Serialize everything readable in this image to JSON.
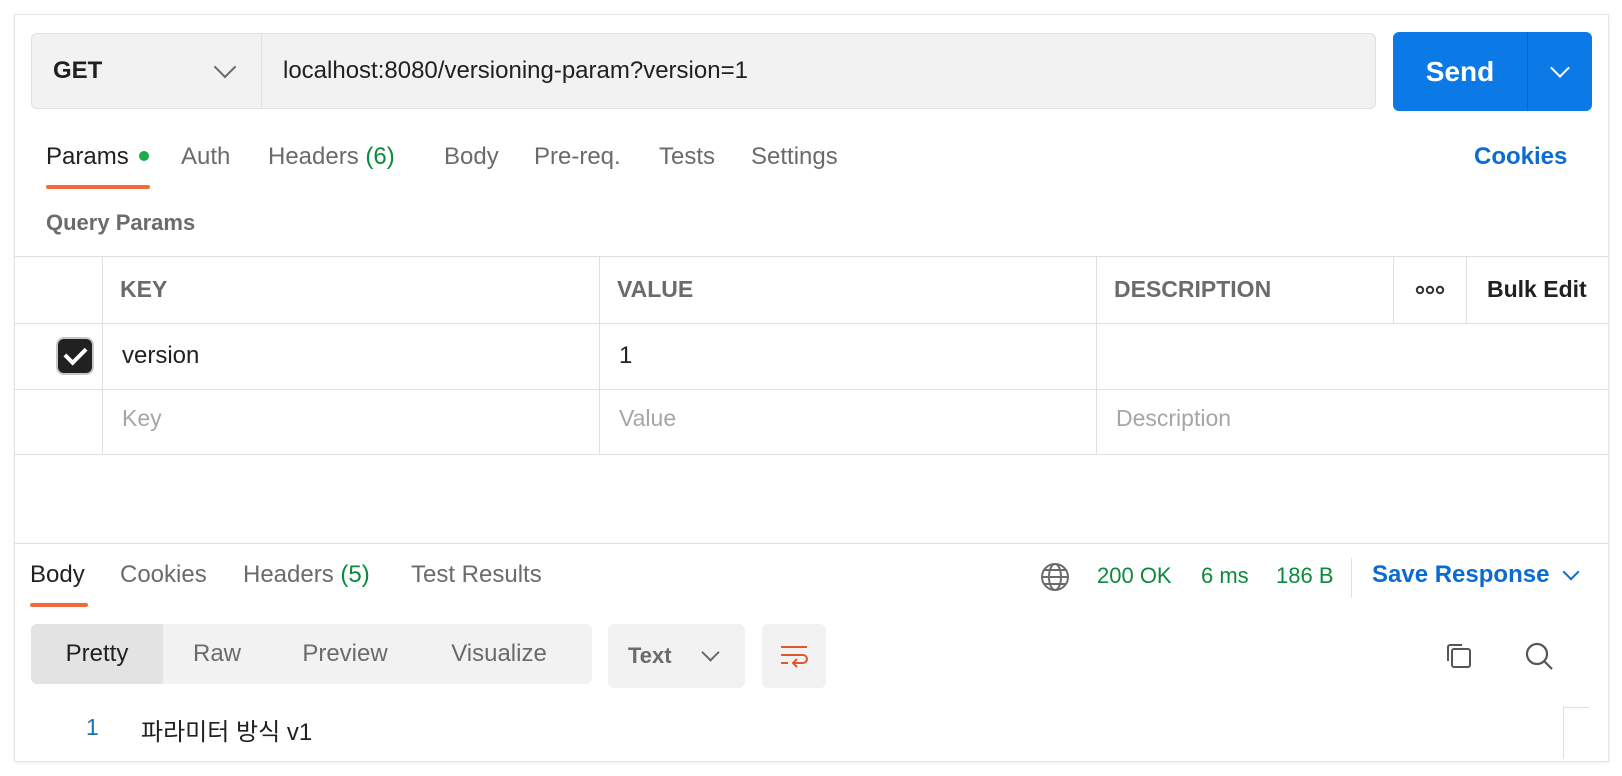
{
  "request": {
    "method": "GET",
    "url": "localhost:8080/versioning-param?version=1",
    "send_label": "Send"
  },
  "tabs": {
    "params": "Params",
    "auth": "Auth",
    "headers": "Headers",
    "headers_count": "(6)",
    "body": "Body",
    "prereq": "Pre-req.",
    "tests": "Tests",
    "settings": "Settings",
    "cookies": "Cookies"
  },
  "query_params": {
    "title": "Query Params",
    "columns": {
      "key": "KEY",
      "value": "VALUE",
      "description": "DESCRIPTION",
      "bulk_edit": "Bulk Edit"
    },
    "rows": [
      {
        "checked": true,
        "key": "version",
        "value": "1",
        "description": ""
      }
    ],
    "placeholders": {
      "key": "Key",
      "value": "Value",
      "description": "Description"
    }
  },
  "response": {
    "tabs": {
      "body": "Body",
      "cookies": "Cookies",
      "headers": "Headers",
      "headers_count": "(5)",
      "test_results": "Test Results"
    },
    "status": "200 OK",
    "time": "6 ms",
    "size": "186 B",
    "save_response": "Save Response",
    "view_modes": [
      "Pretty",
      "Raw",
      "Preview",
      "Visualize"
    ],
    "format": "Text",
    "lines": [
      {
        "number": "1",
        "text": "파라미터 방식 v1"
      }
    ]
  }
}
